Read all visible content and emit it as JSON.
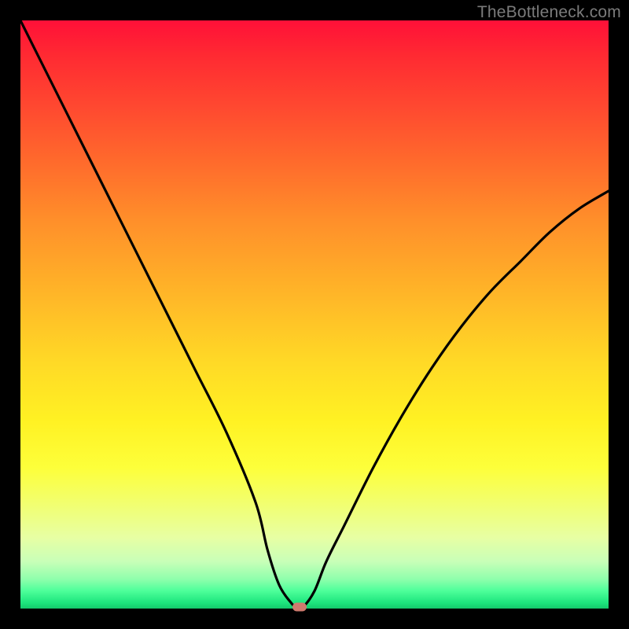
{
  "watermark": "TheBottleneck.com",
  "colors": {
    "frame": "#000000",
    "curve": "#000000",
    "marker": "#cf7a6e"
  },
  "chart_data": {
    "type": "line",
    "title": "",
    "xlabel": "",
    "ylabel": "",
    "xlim": [
      0,
      100
    ],
    "ylim": [
      0,
      100
    ],
    "grid": false,
    "legend": false,
    "curve": {
      "name": "bottleneck-curve",
      "x": [
        0,
        5,
        10,
        15,
        20,
        25,
        30,
        35,
        40,
        42,
        44,
        46,
        47,
        48,
        50,
        52,
        55,
        60,
        65,
        70,
        75,
        80,
        85,
        90,
        95,
        100
      ],
      "y": [
        100,
        90,
        80,
        70,
        60,
        50,
        40,
        30,
        18,
        10,
        4,
        1,
        0.2,
        0.2,
        3,
        8,
        14,
        24,
        33,
        41,
        48,
        54,
        59,
        64,
        68,
        71
      ]
    },
    "marker": {
      "x": 47.5,
      "y": 0.3
    },
    "gradient_stops": [
      {
        "pct": 0,
        "color": "#ff1038"
      },
      {
        "pct": 14,
        "color": "#ff4630"
      },
      {
        "pct": 34,
        "color": "#ff8f2a"
      },
      {
        "pct": 58,
        "color": "#ffd926"
      },
      {
        "pct": 76,
        "color": "#fdff3a"
      },
      {
        "pct": 92,
        "color": "#c8ffb8"
      },
      {
        "pct": 100,
        "color": "#14c96b"
      }
    ]
  }
}
